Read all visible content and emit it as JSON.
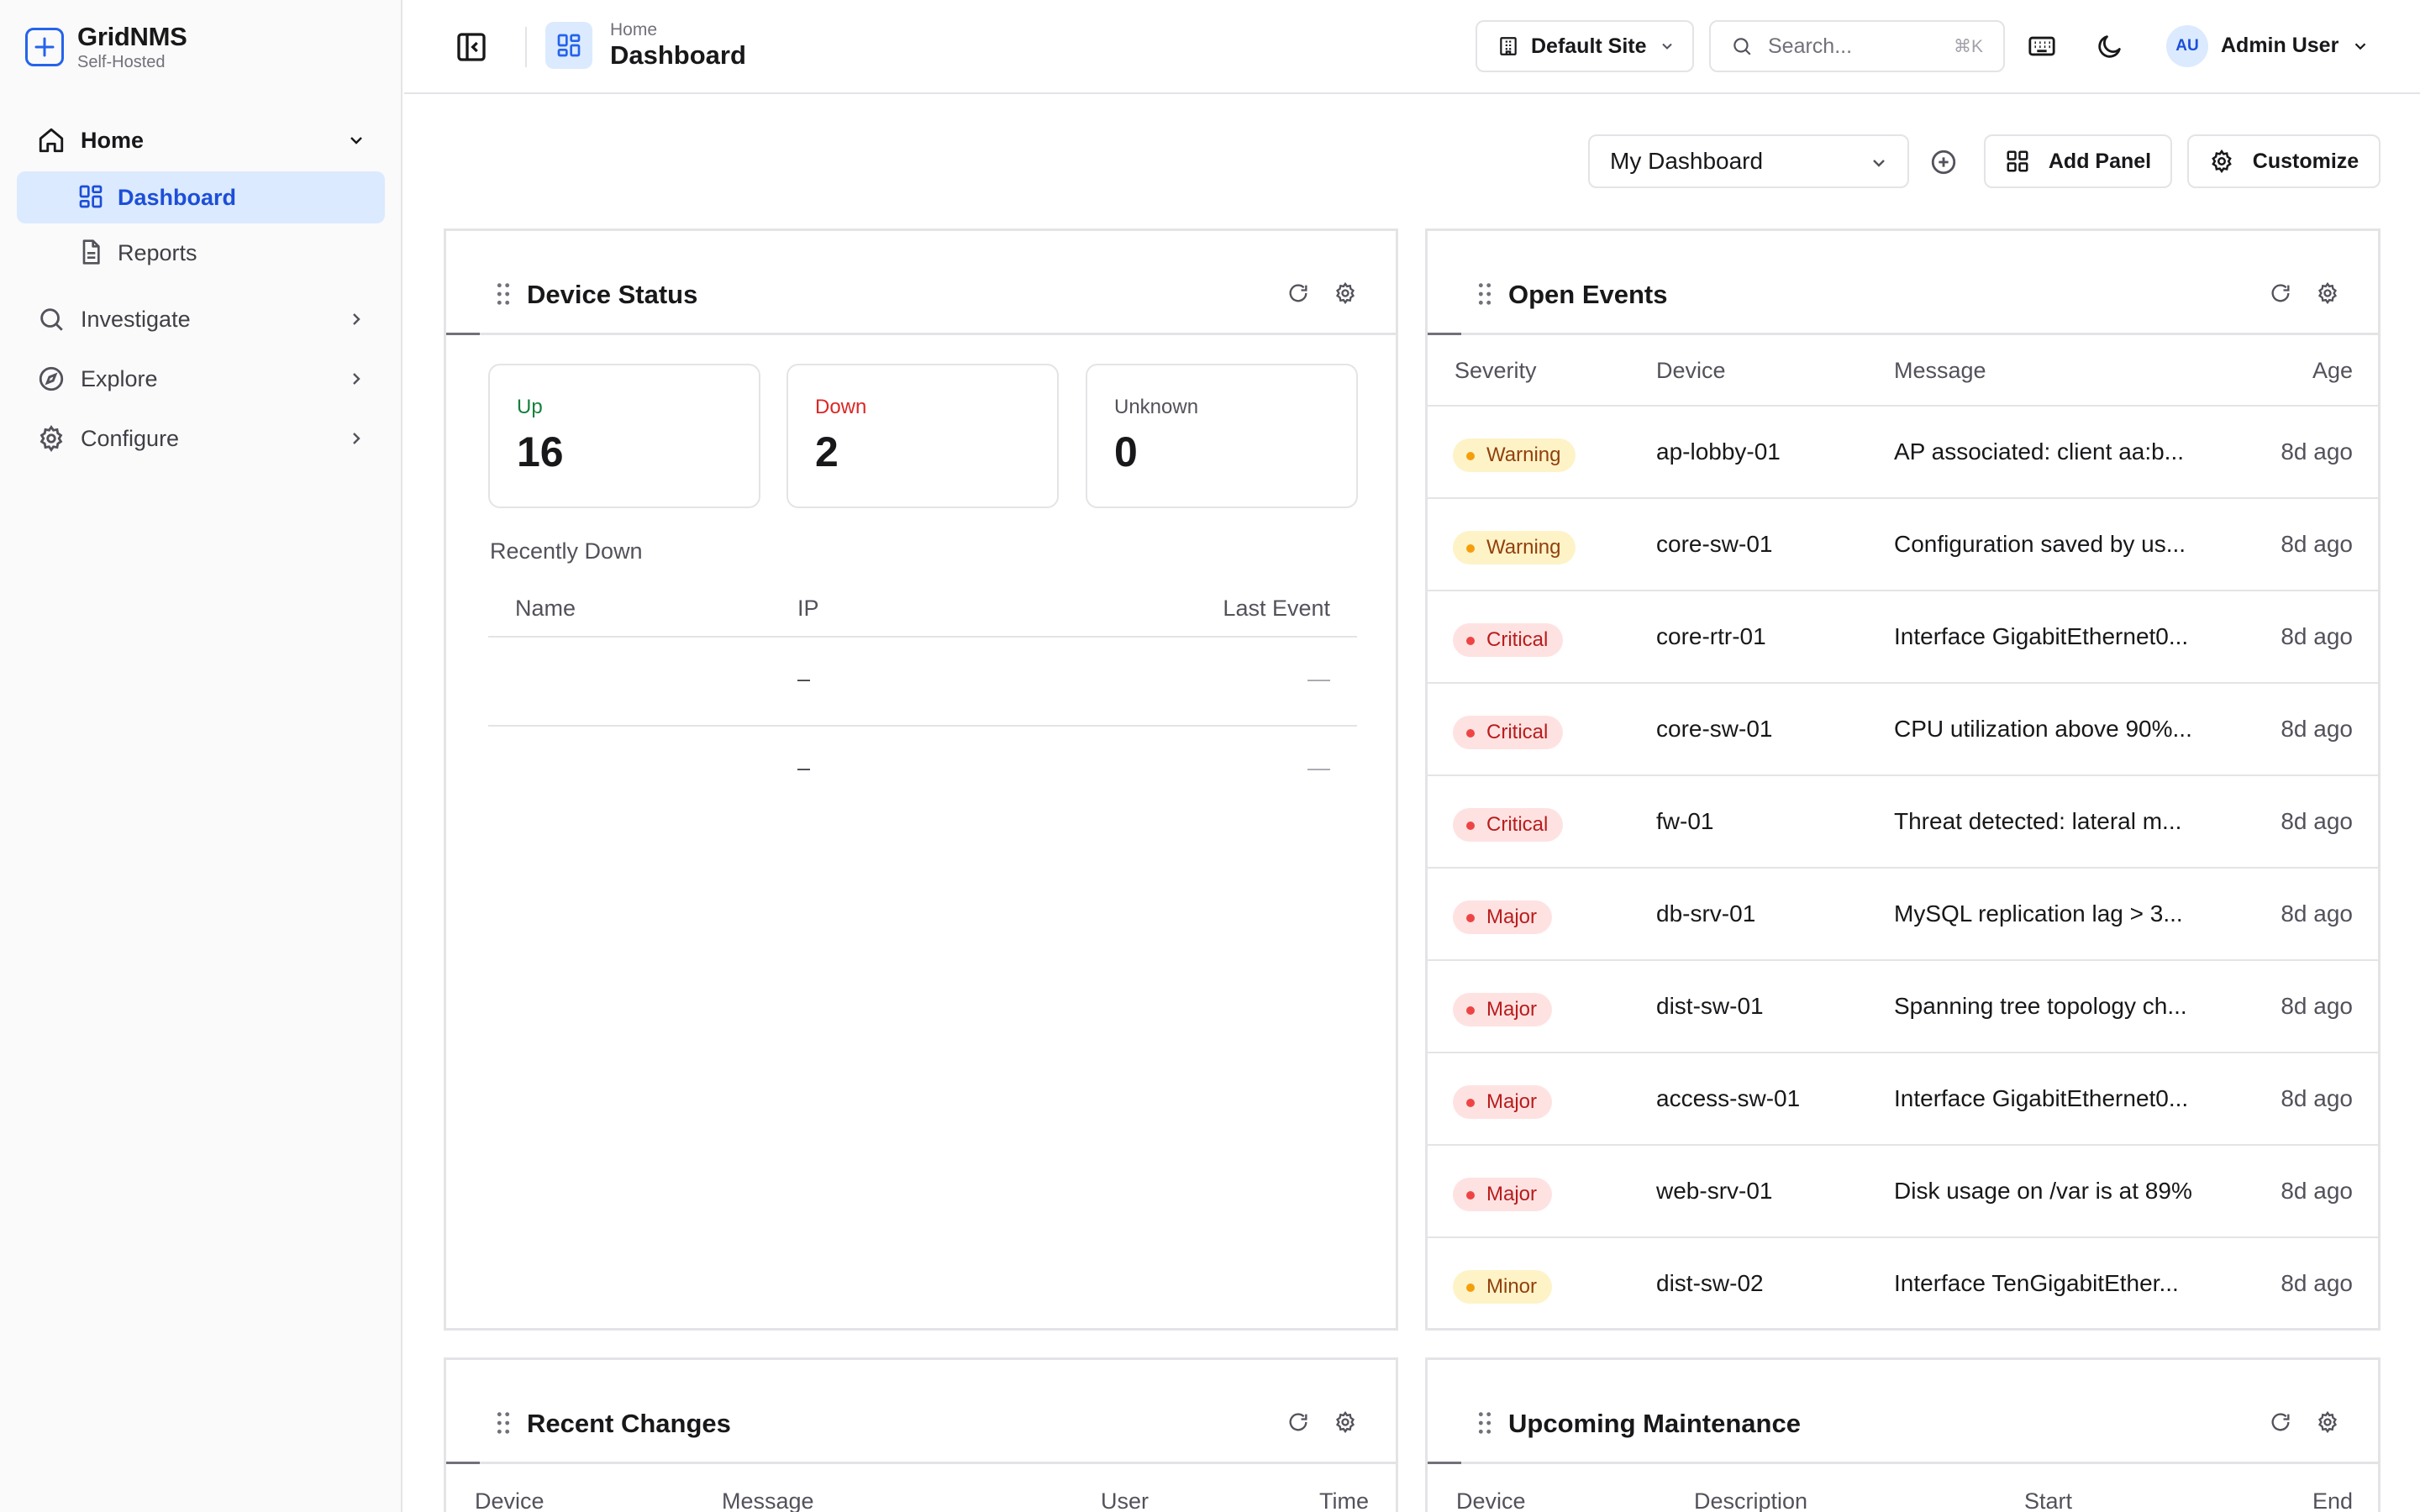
{
  "brand": {
    "name": "GridNMS",
    "subtitle": "Self-Hosted"
  },
  "sidebar": {
    "items": [
      {
        "label": "Home"
      },
      {
        "label": "Dashboard"
      },
      {
        "label": "Reports"
      },
      {
        "label": "Investigate"
      },
      {
        "label": "Explore"
      },
      {
        "label": "Configure"
      }
    ]
  },
  "header": {
    "breadcrumb": "Home",
    "title": "Dashboard",
    "site_label": "Default Site",
    "search_placeholder": "Search...",
    "search_shortcut": "⌘K",
    "user_initials": "AU",
    "user_name": "Admin User"
  },
  "toolbar": {
    "dashboard_select": "My Dashboard",
    "add_panel_label": "Add Panel",
    "customize_label": "Customize"
  },
  "device_status": {
    "title": "Device Status",
    "stats": [
      {
        "label": "Up",
        "value": "16"
      },
      {
        "label": "Down",
        "value": "2"
      },
      {
        "label": "Unknown",
        "value": "0"
      }
    ],
    "recently_down_title": "Recently Down",
    "columns": [
      "Name",
      "IP",
      "Last Event"
    ],
    "rows": [
      {
        "name": "",
        "ip": "–",
        "last_event": "—"
      },
      {
        "name": "",
        "ip": "–",
        "last_event": "—"
      }
    ]
  },
  "open_events": {
    "title": "Open Events",
    "columns": [
      "Severity",
      "Device",
      "Message",
      "Age"
    ],
    "rows": [
      {
        "severity": "Warning",
        "device": "ap-lobby-01",
        "message": "AP associated: client aa:b...",
        "age": "8d ago"
      },
      {
        "severity": "Warning",
        "device": "core-sw-01",
        "message": "Configuration saved by us...",
        "age": "8d ago"
      },
      {
        "severity": "Critical",
        "device": "core-rtr-01",
        "message": "Interface GigabitEthernet0...",
        "age": "8d ago"
      },
      {
        "severity": "Critical",
        "device": "core-sw-01",
        "message": "CPU utilization above 90%...",
        "age": "8d ago"
      },
      {
        "severity": "Critical",
        "device": "fw-01",
        "message": "Threat detected: lateral m...",
        "age": "8d ago"
      },
      {
        "severity": "Major",
        "device": "db-srv-01",
        "message": "MySQL replication lag > 3...",
        "age": "8d ago"
      },
      {
        "severity": "Major",
        "device": "dist-sw-01",
        "message": "Spanning tree topology ch...",
        "age": "8d ago"
      },
      {
        "severity": "Major",
        "device": "access-sw-01",
        "message": "Interface GigabitEthernet0...",
        "age": "8d ago"
      },
      {
        "severity": "Major",
        "device": "web-srv-01",
        "message": "Disk usage on /var is at 89%",
        "age": "8d ago"
      },
      {
        "severity": "Minor",
        "device": "dist-sw-02",
        "message": "Interface TenGigabitEther...",
        "age": "8d ago"
      }
    ]
  },
  "recent_changes": {
    "title": "Recent Changes",
    "columns": [
      "Device",
      "Message",
      "User",
      "Time"
    ]
  },
  "upcoming_maintenance": {
    "title": "Upcoming Maintenance",
    "columns": [
      "Device",
      "Description",
      "Start",
      "End"
    ]
  },
  "colors": {
    "accent": "#2563eb",
    "active_bg": "#dbeafe",
    "up": "#15803d",
    "down": "#dc2626",
    "warning_bg": "#fef3c7",
    "critical_bg": "#fee2e2"
  }
}
